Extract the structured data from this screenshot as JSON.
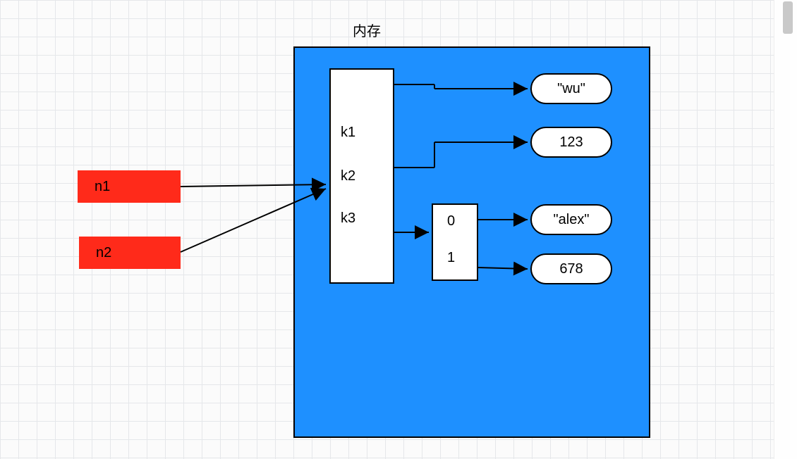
{
  "title": "内存",
  "vars": {
    "n1": "n1",
    "n2": "n2"
  },
  "dict_keys": {
    "k1": "k1",
    "k2": "k2",
    "k3": "k3"
  },
  "list_indices": {
    "i0": "0",
    "i1": "1"
  },
  "values": {
    "v_wu": "\"wu\"",
    "v_123": "123",
    "v_alex": "\"alex\"",
    "v_678": "678"
  }
}
